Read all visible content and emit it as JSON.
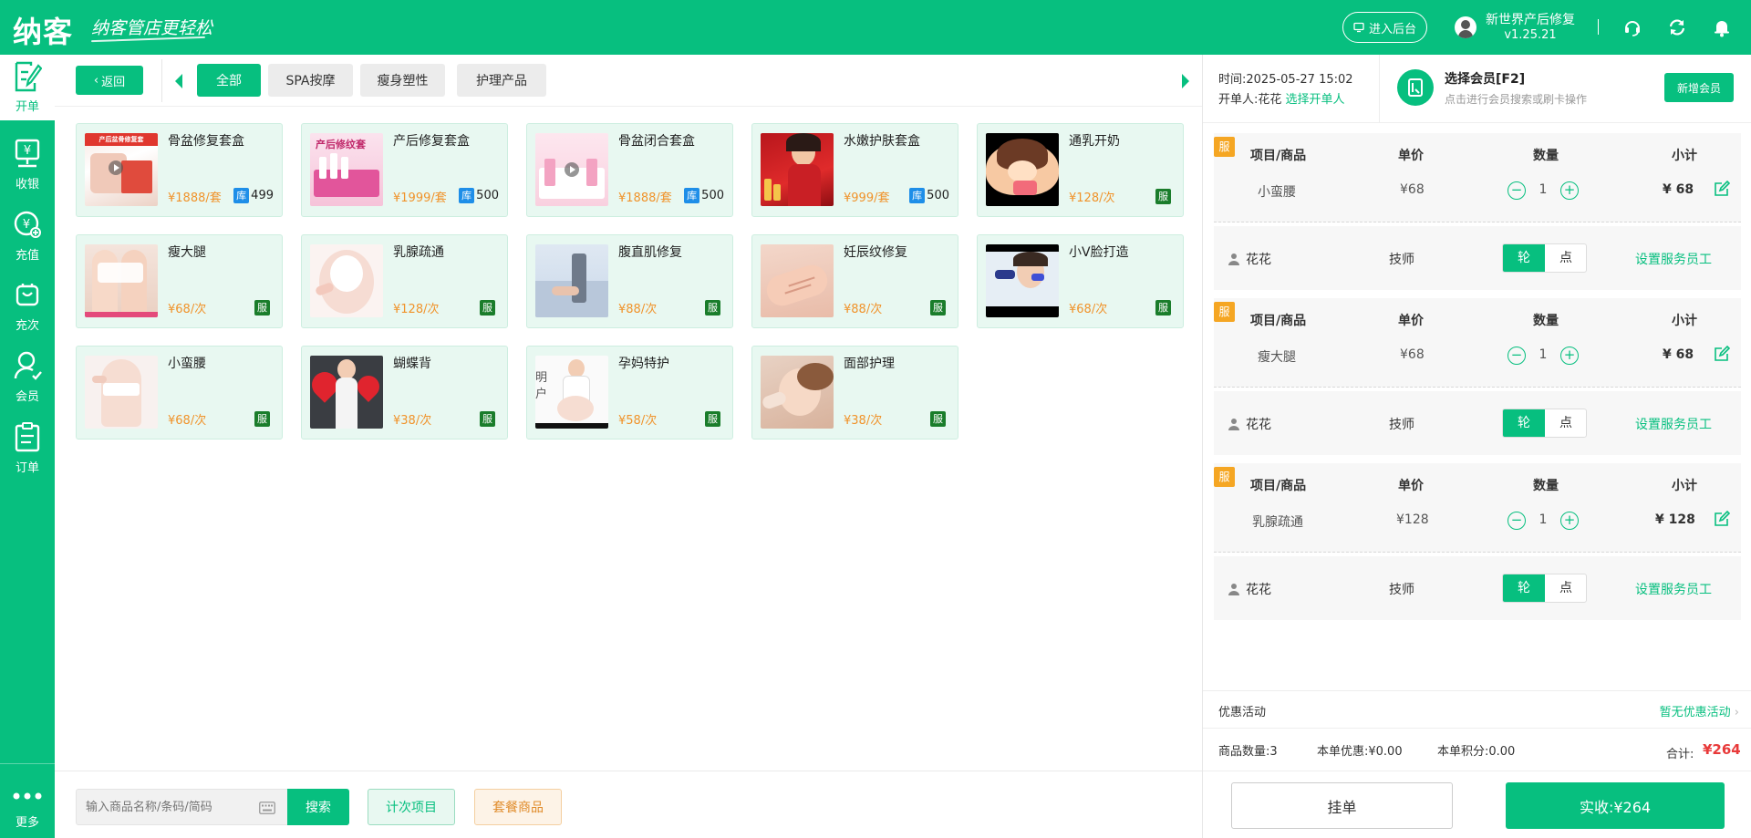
{
  "header": {
    "logo": "纳客",
    "slogan": "纳客管店更轻松",
    "backend_btn": "进入后台",
    "store_name": "新世界产后修复",
    "version": "v1.25.21"
  },
  "leftnav": {
    "items": [
      {
        "label": "开单",
        "icon": "edit-order-icon"
      },
      {
        "label": "收银",
        "icon": "cashier-icon"
      },
      {
        "label": "充值",
        "icon": "recharge-icon"
      },
      {
        "label": "充次",
        "icon": "recharge-times-icon"
      },
      {
        "label": "会员",
        "icon": "member-icon"
      },
      {
        "label": "订单",
        "icon": "order-list-icon"
      },
      {
        "label": "更多",
        "icon": "more-icon"
      }
    ]
  },
  "category_bar": {
    "back_label": "返回",
    "tabs": [
      "全部",
      "SPA按摩",
      "瘦身塑性",
      "护理产品"
    ]
  },
  "products": [
    {
      "name": "骨盆修复套盒",
      "price": "¥1888/套",
      "stock": "499",
      "stock_badge": "库",
      "thumb_text": "产后盆骨修复套"
    },
    {
      "name": "产后修复套盒",
      "price": "¥1999/套",
      "stock": "500",
      "stock_badge": "库",
      "thumb_text": "产后修纹套"
    },
    {
      "name": "骨盆闭合套盒",
      "price": "¥1888/套",
      "stock": "500",
      "stock_badge": "库",
      "thumb_text": ""
    },
    {
      "name": "水嫩护肤套盒",
      "price": "¥999/套",
      "stock": "500",
      "stock_badge": "库",
      "thumb_text": ""
    },
    {
      "name": "通乳开奶",
      "price": "¥128/次",
      "service_badge": "服",
      "thumb_text": ""
    },
    {
      "name": "瘦大腿",
      "price": "¥68/次",
      "service_badge": "服",
      "thumb_text": ""
    },
    {
      "name": "乳腺疏通",
      "price": "¥128/次",
      "service_badge": "服",
      "thumb_text": ""
    },
    {
      "name": "腹直肌修复",
      "price": "¥88/次",
      "service_badge": "服",
      "thumb_text": ""
    },
    {
      "name": "妊辰纹修复",
      "price": "¥88/次",
      "service_badge": "服",
      "thumb_text": ""
    },
    {
      "name": "小V脸打造",
      "price": "¥68/次",
      "service_badge": "服",
      "thumb_text": ""
    },
    {
      "name": "小蛮腰",
      "price": "¥68/次",
      "service_badge": "服",
      "thumb_text": ""
    },
    {
      "name": "蝴蝶背",
      "price": "¥38/次",
      "service_badge": "服",
      "thumb_text": ""
    },
    {
      "name": "孕妈特护",
      "price": "¥58/次",
      "service_badge": "服",
      "thumb_text": "明户"
    },
    {
      "name": "面部护理",
      "price": "¥38/次",
      "service_badge": "服",
      "thumb_text": ""
    }
  ],
  "bottom_bar": {
    "search_placeholder": "输入商品名称/条码/简码",
    "search_btn": "搜索",
    "count_btn": "计次项目",
    "combo_btn": "套餐商品"
  },
  "right_panel": {
    "time_label": "时间:",
    "time_value": "2025-05-27 15:02",
    "opener_label": "开单人:",
    "opener_value": "花花",
    "opener_link": "选择开单人",
    "member_title": "选择会员[F2]",
    "member_sub": "点击进行会员搜索或刷卡操作",
    "new_member_btn": "新增会员",
    "columns": {
      "item": "项目/商品",
      "price": "单价",
      "qty": "数量",
      "subtotal": "小计"
    },
    "orders": [
      {
        "tag": "服",
        "item": "小蛮腰",
        "price": "¥68",
        "qty": "1",
        "subtotal": "¥ 68",
        "staff": "花花",
        "role": "技师",
        "on": "轮",
        "off": "点",
        "set": "设置服务员工"
      },
      {
        "tag": "服",
        "item": "瘦大腿",
        "price": "¥68",
        "qty": "1",
        "subtotal": "¥ 68",
        "staff": "花花",
        "role": "技师",
        "on": "轮",
        "off": "点",
        "set": "设置服务员工"
      },
      {
        "tag": "服",
        "item": "乳腺疏通",
        "price": "¥128",
        "qty": "1",
        "subtotal": "¥ 128",
        "staff": "花花",
        "role": "技师",
        "on": "轮",
        "off": "点",
        "set": "设置服务员工"
      }
    ],
    "promo_label": "优惠活动",
    "promo_value": "暂无优惠活动",
    "summary": {
      "count": "商品数量:3",
      "discount": "本单优惠:¥0.00",
      "points": "本单积分:0.00",
      "total_label": "合计:",
      "total": "¥264"
    },
    "hold_btn": "挂单",
    "pay_btn": "实收:¥264"
  },
  "colors": {
    "accent": "#07bf7f",
    "price": "#f0932b",
    "total": "#e83a3a",
    "tag": "#f5a623"
  }
}
